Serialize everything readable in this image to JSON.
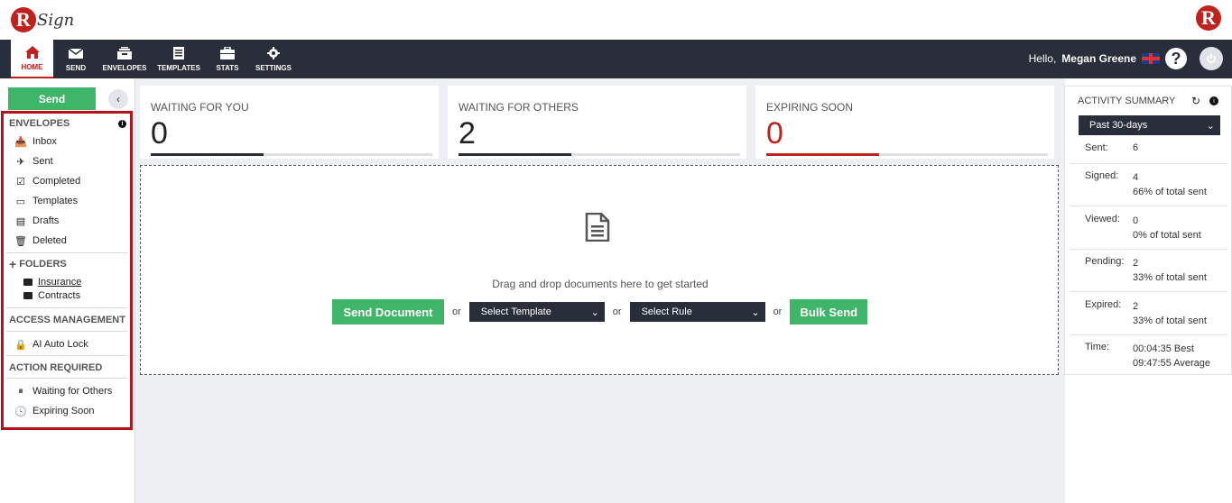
{
  "header": {
    "logo_r": "R",
    "logo_text": "Sign"
  },
  "nav": {
    "items": [
      {
        "label": "HOME",
        "icon": "home-icon"
      },
      {
        "label": "SEND",
        "icon": "envelope-icon"
      },
      {
        "label": "ENVELOPES",
        "icon": "inbox-tray-icon"
      },
      {
        "label": "TEMPLATES",
        "icon": "templates-icon"
      },
      {
        "label": "STATS",
        "icon": "briefcase-icon"
      },
      {
        "label": "SETTINGS",
        "icon": "gear-icon"
      }
    ],
    "greeting": "Hello,",
    "user_name": "Megan Greene",
    "help_label": "?"
  },
  "sidebar": {
    "send_label": "Send",
    "envelopes_title": "ENVELOPES",
    "envelope_items": [
      "Inbox",
      "Sent",
      "Completed",
      "Templates",
      "Drafts",
      "Deleted"
    ],
    "folders_title": "FOLDERS",
    "folders": [
      "Insurance",
      "Contracts"
    ],
    "access_title": "ACCESS MANAGEMENT",
    "access_items": [
      "AI Auto Lock"
    ],
    "action_title": "ACTION REQUIRED",
    "action_items": [
      "Waiting for Others",
      "Expiring Soon"
    ]
  },
  "stats": [
    {
      "label": "WAITING FOR YOU",
      "value": "0",
      "bar_color": "#2a2e3b"
    },
    {
      "label": "WAITING FOR OTHERS",
      "value": "2",
      "bar_color": "#2a2e3b"
    },
    {
      "label": "EXPIRING SOON",
      "value": "0",
      "bar_color": "#c0211d"
    }
  ],
  "dropzone": {
    "text": "Drag and drop documents here to get started",
    "send_document": "Send Document",
    "or": "or",
    "select_template": "Select Template",
    "select_rule": "Select Rule",
    "bulk_send": "Bulk Send"
  },
  "activity": {
    "title": "ACTIVITY SUMMARY",
    "period": "Past 30-days",
    "rows": [
      {
        "key": "Sent:",
        "line1": "6",
        "line2": ""
      },
      {
        "key": "Signed:",
        "line1": "4",
        "line2": "66% of total sent"
      },
      {
        "key": "Viewed:",
        "line1": "0",
        "line2": "0% of total sent"
      },
      {
        "key": "Pending:",
        "line1": "2",
        "line2": "33% of total sent"
      },
      {
        "key": "Expired:",
        "line1": "2",
        "line2": "33% of total sent"
      },
      {
        "key": "Time:",
        "line1": "00:04:35 Best",
        "line2": "09:47:55 Average"
      }
    ]
  },
  "colors": {
    "brand_red": "#c0211d",
    "navbar": "#2a2e3b",
    "green": "#3fb569",
    "highlight_border": "#b5121b"
  }
}
